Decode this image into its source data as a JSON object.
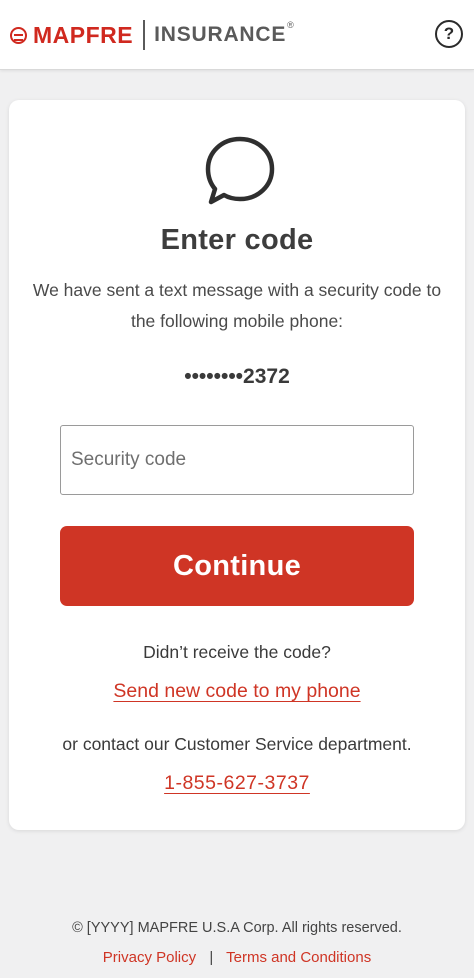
{
  "header": {
    "brand": "MAPFRE",
    "product": "INSURANCE",
    "registered_mark": "®",
    "help_icon": "question-circle-icon",
    "help_label": "?"
  },
  "card": {
    "icon": "chat-bubble-icon",
    "title": "Enter code",
    "description": "We have sent a text message with a security code to the following mobile phone:",
    "masked_phone": "••••••••2372",
    "code_input": {
      "value": "",
      "placeholder": "Security code"
    },
    "continue_label": "Continue",
    "resend_question": "Didn’t receive the code?",
    "resend_link": "Send new code to my phone",
    "contact_text": "or contact our Customer Service department.",
    "phone_number": "1-855-627-3737"
  },
  "footer": {
    "copyright": "© [YYYY] MAPFRE U.S.A Corp. All rights reserved.",
    "privacy_link": "Privacy Policy",
    "separator": "|",
    "terms_link": "Terms and Conditions"
  },
  "colors": {
    "brand_red": "#d0291f",
    "button_red": "#cf3525",
    "background": "#f0f0f1",
    "card": "#ffffff"
  }
}
